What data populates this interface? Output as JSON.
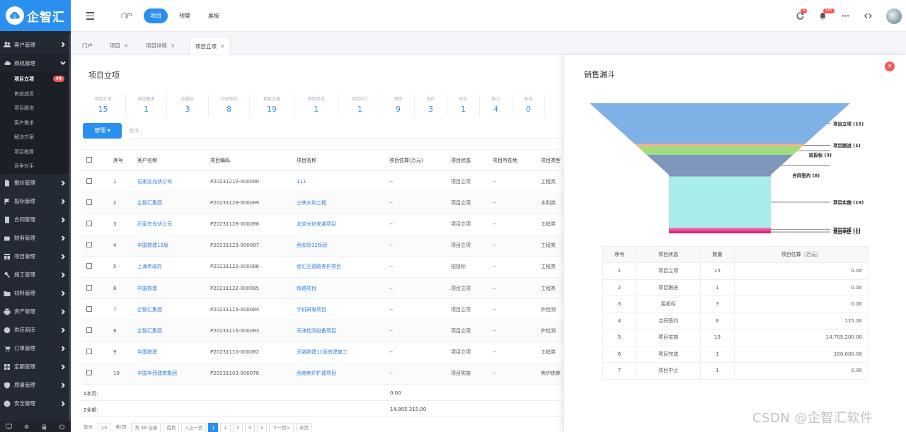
{
  "app": {
    "logo_text": "企智汇",
    "watermark": "CSDN @企智汇软件"
  },
  "sidebar": {
    "items": [
      {
        "label": "客户管理",
        "icon": "users-icon"
      },
      {
        "label": "商机管理",
        "icon": "cloud-icon",
        "open": true
      },
      {
        "label": "报价管理",
        "icon": "doc-icon"
      },
      {
        "label": "投标管理",
        "icon": "flag-icon"
      },
      {
        "label": "合同管理",
        "icon": "contract-icon"
      },
      {
        "label": "财务管理",
        "icon": "wallet-icon"
      },
      {
        "label": "项目管理",
        "icon": "grid-icon"
      },
      {
        "label": "施工管理",
        "icon": "hammer-icon"
      },
      {
        "label": "材料管理",
        "icon": "folder-icon"
      },
      {
        "label": "资产管理",
        "icon": "printer-icon"
      },
      {
        "label": "供应商库",
        "icon": "globe-icon"
      },
      {
        "label": "订单管理",
        "icon": "cart-icon"
      },
      {
        "label": "定额管理",
        "icon": "blocks-icon"
      },
      {
        "label": "质量管理",
        "icon": "shield-icon"
      },
      {
        "label": "安全管理",
        "icon": "safety-icon"
      }
    ],
    "sub_items": [
      {
        "label": "项目立项",
        "badge": "48",
        "active": true
      },
      {
        "label": "售前成员"
      },
      {
        "label": "项目跟进"
      },
      {
        "label": "客户需求"
      },
      {
        "label": "解决方案"
      },
      {
        "label": "项目概算"
      },
      {
        "label": "竞争对手"
      }
    ]
  },
  "topbar": {
    "nav": [
      {
        "label": "门户"
      },
      {
        "label": "项目",
        "active": true
      },
      {
        "label": "预警"
      },
      {
        "label": "展板"
      }
    ],
    "badges": {
      "refresh": "6",
      "bell": "145"
    }
  },
  "tabs": [
    {
      "label": "门户",
      "closable": false
    },
    {
      "label": "项目",
      "closable": true
    },
    {
      "label": "项目详情",
      "closable": true
    },
    {
      "label": "项目立项",
      "closable": true,
      "active": true
    }
  ],
  "main": {
    "title": "项目立项",
    "stats": [
      {
        "label": "项目立项",
        "value": "15"
      },
      {
        "label": "项目跟进",
        "value": "1"
      },
      {
        "label": "招投标",
        "value": "3"
      },
      {
        "label": "合同签约",
        "value": "8"
      },
      {
        "label": "项目实施",
        "value": "19"
      },
      {
        "label": "项目完成",
        "value": "1"
      },
      {
        "label": "项目中止",
        "value": "1"
      },
      {
        "label": "钢铁",
        "value": "9"
      },
      {
        "label": "光伏",
        "value": "3"
      },
      {
        "label": "石化",
        "value": "1"
      },
      {
        "label": "电力",
        "value": "4"
      },
      {
        "label": "有色",
        "value": "0"
      }
    ],
    "manage_label": "管理 ▾",
    "search_placeholder": "查询...",
    "columns": [
      "序号",
      "客户名称",
      "项目编码",
      "项目名称",
      "项目估算(万元)",
      "项目状态",
      "项目所在地",
      "项目类型"
    ],
    "rows": [
      {
        "no": "1",
        "customer": "石家庄光伏公司",
        "code": "P20231210-000090",
        "name": "111",
        "estimate": "--",
        "status": "项目立项",
        "location": "--",
        "type": "工程类"
      },
      {
        "no": "2",
        "customer": "企智汇集团",
        "code": "P20231129-000089",
        "name": "三峡水利工程",
        "estimate": "--",
        "status": "项目立项",
        "location": "--",
        "type": "水利类"
      },
      {
        "no": "3",
        "customer": "石家庄光伏公司",
        "code": "P20231128-000088",
        "name": "北京光伏安装项目",
        "estimate": "--",
        "status": "项目立项",
        "location": "--",
        "type": "工程类"
      },
      {
        "no": "4",
        "customer": "中国铁建12局",
        "code": "P20231123-000087",
        "name": "西安段12标段",
        "estimate": "--",
        "status": "项目立项",
        "location": "--",
        "type": "工程类"
      },
      {
        "no": "5",
        "customer": "上海市政府",
        "code": "P20231122-000086",
        "name": "徐汇区道路养护项目",
        "estimate": "--",
        "status": "招投标",
        "location": "--",
        "type": "工程类"
      },
      {
        "no": "6",
        "customer": "中国铁建",
        "code": "P20231122-000085",
        "name": "铁路项目",
        "estimate": "--",
        "status": "项目立项",
        "location": "--",
        "type": "工程类"
      },
      {
        "no": "7",
        "customer": "企智汇集团",
        "code": "P20231115-000084",
        "name": "手机研发项目",
        "estimate": "--",
        "status": "项目立项",
        "location": "--",
        "type": "外检测"
      },
      {
        "no": "8",
        "customer": "企智汇集团",
        "code": "P20231115-000083",
        "name": "天津检测设备项目",
        "estimate": "--",
        "status": "项目立项",
        "location": "--",
        "type": "外检测"
      },
      {
        "no": "9",
        "customer": "中国铁建",
        "code": "P20231110-000082",
        "name": "无锡铁建11局房建施工",
        "estimate": "--",
        "status": "项目立项",
        "location": "--",
        "type": "工程类"
      },
      {
        "no": "10",
        "customer": "中国华西建筑集团",
        "code": "P20231103-000078",
        "name": "西南焦炉扩建项目",
        "estimate": "--",
        "status": "项目实施",
        "location": "--",
        "type": "焦炉炼焦"
      }
    ],
    "sum_page_label": "Σ本页:",
    "sum_page_value": "0.00",
    "sum_all_label": "Σ全部:",
    "sum_all_value": "14,805,315.00",
    "pager": {
      "show": "显示",
      "size": "10",
      "per_page": "条/页",
      "total": "共 48 记录",
      "first": "首页",
      "prev": "<上一页",
      "pages": [
        "1",
        "2",
        "3",
        "4",
        "5"
      ],
      "next": "下一页>",
      "last": "末页"
    }
  },
  "panel": {
    "title": "销售漏斗",
    "close": "×",
    "table_columns": [
      "序号",
      "项目状态",
      "数量",
      "项目估算（万元）"
    ],
    "table_rows": [
      {
        "no": "1",
        "status": "项目立项",
        "count": "15",
        "estimate": "0.00"
      },
      {
        "no": "2",
        "status": "项目跟进",
        "count": "1",
        "estimate": "0.00"
      },
      {
        "no": "3",
        "status": "招投标",
        "count": "3",
        "estimate": "0.00"
      },
      {
        "no": "4",
        "status": "合同签约",
        "count": "8",
        "estimate": "115.00"
      },
      {
        "no": "5",
        "status": "项目实施",
        "count": "19",
        "estimate": "14,705,200.00"
      },
      {
        "no": "6",
        "status": "项目完成",
        "count": "1",
        "estimate": "100,000.00"
      },
      {
        "no": "7",
        "status": "项目中止",
        "count": "1",
        "estimate": "0.00"
      }
    ]
  },
  "chart_data": {
    "type": "funnel",
    "title": "销售漏斗",
    "categories": [
      "项目立项",
      "项目跟进",
      "招投标",
      "合同签约",
      "项目实施",
      "项目完成",
      "项目中止"
    ],
    "values": [
      15,
      1,
      3,
      8,
      19,
      1,
      1
    ],
    "labels": [
      "项目立项 (15)",
      "项目跟进 (1)",
      "招投标 (3)",
      "合同签约 (8)",
      "项目实施 (19)",
      "项目完成 (1)",
      "项目中止 (1)"
    ],
    "colors": [
      "#7fb0e6",
      "#f4b183",
      "#9ddf7f",
      "#7f96bd",
      "#a9ecec",
      "#f05aa6",
      "#e0247f"
    ]
  }
}
